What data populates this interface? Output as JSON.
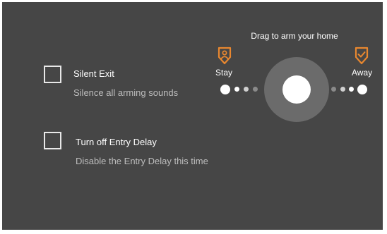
{
  "options": [
    {
      "title": "Silent Exit",
      "subtitle": "Silence all arming sounds",
      "checked": false
    },
    {
      "title": "Turn off Entry Delay",
      "subtitle": "Disable the Entry Delay this time",
      "checked": false
    }
  ],
  "arm_slider": {
    "hint": "Drag to arm your home",
    "left_mode": {
      "label": "Stay",
      "icon": "shield-person-icon"
    },
    "right_mode": {
      "label": "Away",
      "icon": "shield-check-icon"
    },
    "accent_color": "#e8872f",
    "knob_color": "#ffffff",
    "track_color": "#6b6b6b"
  }
}
